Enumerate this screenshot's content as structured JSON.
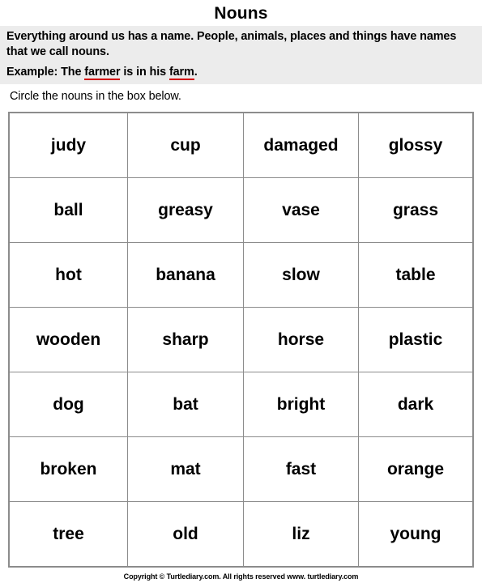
{
  "title": "Nouns",
  "intro": {
    "paragraph": "Everything around us has a name. People, animals, places and things have names that we call nouns.",
    "example_prefix": "Example: The ",
    "example_word1": "farmer",
    "example_middle": " is in his ",
    "example_word2": "farm",
    "example_suffix": "."
  },
  "directions": "Circle the nouns in the box below.",
  "grid": {
    "rows": [
      [
        "judy",
        "cup",
        "damaged",
        "glossy"
      ],
      [
        "ball",
        "greasy",
        "vase",
        "grass"
      ],
      [
        "hot",
        "banana",
        "slow",
        "table"
      ],
      [
        "wooden",
        "sharp",
        "horse",
        "plastic"
      ],
      [
        "dog",
        "bat",
        "bright",
        "dark"
      ],
      [
        "broken",
        "mat",
        "fast",
        "orange"
      ],
      [
        "tree",
        "old",
        "liz",
        "young"
      ]
    ]
  },
  "footer": {
    "text": "Copyright © Turtlediary.com. All rights reserved  www. turtlediary.com"
  },
  "colors": {
    "band_background": "#ececec",
    "underline_red": "#d40000",
    "grid_border": "#8c8c8c"
  }
}
